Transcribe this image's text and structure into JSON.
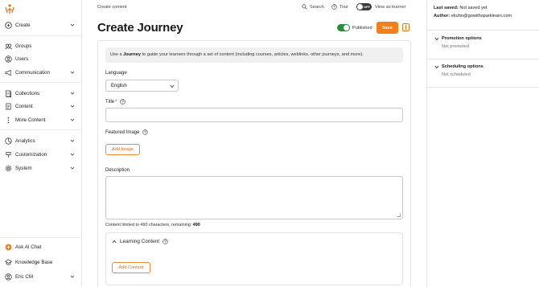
{
  "sidebar": {
    "items": [
      {
        "label": "Create",
        "icon": "plus-circle-icon",
        "chevron": true
      },
      {
        "label": "Groups",
        "icon": "groups-icon",
        "chevron": false
      },
      {
        "label": "Users",
        "icon": "user-icon",
        "chevron": false
      },
      {
        "label": "Communication",
        "icon": "megaphone-icon",
        "chevron": true
      },
      {
        "label": "Collections",
        "icon": "collections-icon",
        "chevron": true
      },
      {
        "label": "Content",
        "icon": "document-icon",
        "chevron": true
      },
      {
        "label": "More Content",
        "icon": "more-vertical-icon",
        "chevron": true
      },
      {
        "label": "Analytics",
        "icon": "analytics-icon",
        "chevron": true
      },
      {
        "label": "Customization",
        "icon": "paint-icon",
        "chevron": true
      },
      {
        "label": "System",
        "icon": "gear-icon",
        "chevron": true
      }
    ],
    "bottom": [
      {
        "label": "Ask AI Chat",
        "icon": "ai-chat-icon"
      },
      {
        "label": "Knowledge Base",
        "icon": "knowledge-base-icon"
      },
      {
        "label": "Eric CM",
        "icon": "avatar-icon"
      }
    ]
  },
  "topbar": {
    "breadcrumb": "Create content",
    "search_label": "Search",
    "tour_label": "Tour",
    "learner_toggle_state": "OFF",
    "learner_label": "View as learner"
  },
  "header": {
    "title": "Create Journey",
    "published_label": "Published",
    "save_label": "Save",
    "accent_color": "#f27f1b",
    "toggle_color": "#2e8b3a"
  },
  "form": {
    "info_prefix": "Use a ",
    "info_strong": "Journey",
    "info_suffix": " to guide your learners through a set of content (including courses, articles, weblinks, other journeys, and more).",
    "language_label": "Language",
    "language_value": "English",
    "title_label": "Title",
    "title_required_mark": "*",
    "title_value": "",
    "featured_image_label": "Featured Image",
    "add_image_label": "Add Image",
    "description_label": "Description",
    "description_value": "",
    "limit_text": "Content limited to 490 characters, remaining: ",
    "limit_remaining": "490",
    "learning_content_label": "Learning Content",
    "add_content_label": "Add Content"
  },
  "right_panel": {
    "last_saved_label": "Last saved:",
    "last_saved_value": "Not saved yet",
    "author_label": "Author:",
    "author_value": "ekuhn@gowithsparklearn.com",
    "promotion_title": "Promotion options",
    "promotion_status": "Not promoted",
    "scheduling_title": "Scheduling options",
    "scheduling_status": "Not scheduled"
  }
}
